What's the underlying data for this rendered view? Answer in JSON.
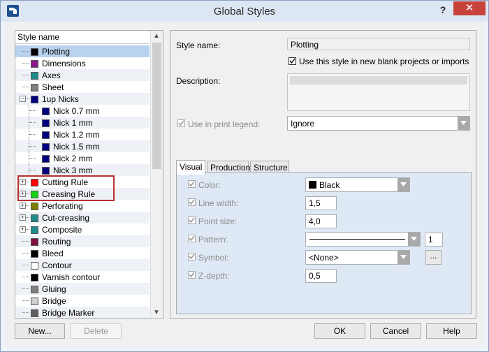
{
  "window": {
    "title": "Global Styles",
    "help_glyph": "?",
    "close_glyph": "✕"
  },
  "tree": {
    "header": "Style name",
    "items": [
      {
        "label": "Plotting",
        "color": "#000000",
        "selected": true
      },
      {
        "label": "Dimensions",
        "color": "#8b1a8b"
      },
      {
        "label": "Axes",
        "color": "#1f8c8c"
      },
      {
        "label": "Sheet",
        "color": "#808080"
      },
      {
        "label": "1up Nicks",
        "color": "#00007f",
        "expanded": true
      },
      {
        "label": "Nick 0.7 mm",
        "color": "#00007f"
      },
      {
        "label": "Nick 1 mm",
        "color": "#00007f"
      },
      {
        "label": "Nick 1.2 mm",
        "color": "#00007f"
      },
      {
        "label": "Nick 1.5 mm",
        "color": "#00007f"
      },
      {
        "label": "Nick 2 mm",
        "color": "#00007f"
      },
      {
        "label": "Nick 3 mm",
        "color": "#00007f"
      },
      {
        "label": "Cutting Rule",
        "color": "#ff0000"
      },
      {
        "label": "Creasing Rule",
        "color": "#19d219"
      },
      {
        "label": "Perforating",
        "color": "#7f7f00"
      },
      {
        "label": "Cut-creasing",
        "color": "#1f8c8c"
      },
      {
        "label": "Composite",
        "color": "#1f8c8c"
      },
      {
        "label": "Routing",
        "color": "#7f0f3f"
      },
      {
        "label": "Bleed",
        "color": "#000000"
      },
      {
        "label": "Contour",
        "color": "#ffffff"
      },
      {
        "label": "Varnish contour",
        "color": "#000000"
      },
      {
        "label": "Gluing",
        "color": "#808080"
      },
      {
        "label": "Bridge",
        "color": "#d0d0d0"
      },
      {
        "label": "Bridge Marker",
        "color": "#606060"
      }
    ]
  },
  "details": {
    "style_name_label": "Style name:",
    "style_name_value": "Plotting",
    "use_in_new_label": "Use this style in new blank projects or imports",
    "description_label": "Description:",
    "print_legend_label": "Use in print legend:",
    "print_legend_value": "Ignore"
  },
  "tabs": [
    "Visual",
    "Production",
    "Structure"
  ],
  "visual": {
    "color_label": "Color:",
    "color_value": "Black",
    "line_width_label": "Line width:",
    "line_width_value": "1,5",
    "point_size_label": "Point size:",
    "point_size_value": "4,0",
    "pattern_label": "Pattern:",
    "pattern_number": "1",
    "symbol_label": "Symbol:",
    "symbol_value": "<None>",
    "symbol_button": "...",
    "zdepth_label": "Z-depth:",
    "zdepth_value": "0,5"
  },
  "buttons": {
    "new": "New...",
    "delete": "Delete",
    "ok": "OK",
    "cancel": "Cancel",
    "help": "Help"
  }
}
